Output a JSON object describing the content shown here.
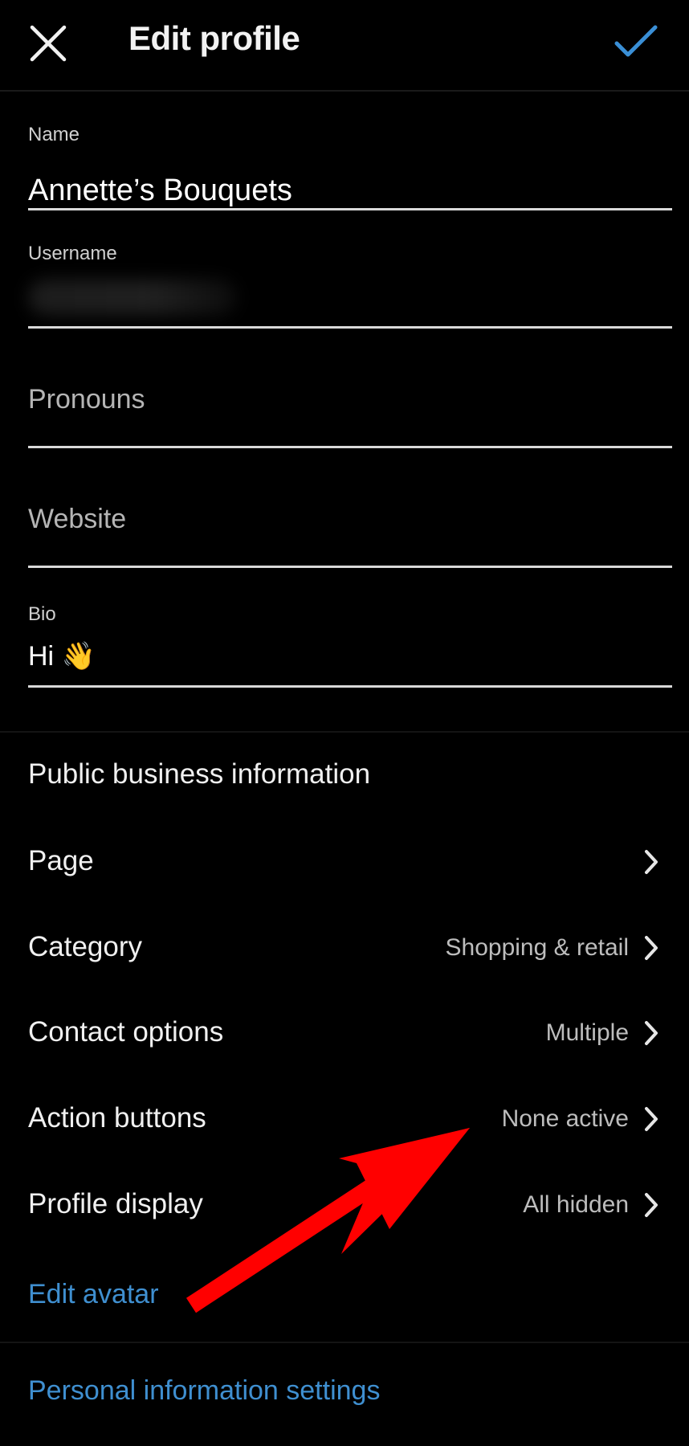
{
  "header": {
    "title": "Edit profile",
    "close_icon": "close-icon",
    "confirm_icon": "check-icon",
    "accent_color": "#3a8fd6"
  },
  "form": {
    "name": {
      "label": "Name",
      "value": "Annette’s Bouquets"
    },
    "username": {
      "label": "Username",
      "value_blurred": true
    },
    "pronouns": {
      "placeholder": "Pronouns"
    },
    "website": {
      "placeholder": "Website"
    },
    "bio": {
      "label": "Bio",
      "value": "Hi 👋"
    }
  },
  "business": {
    "section_title": "Public business information",
    "rows": [
      {
        "label": "Page",
        "value": ""
      },
      {
        "label": "Category",
        "value": "Shopping & retail"
      },
      {
        "label": "Contact options",
        "value": "Multiple"
      },
      {
        "label": "Action buttons",
        "value": "None active"
      },
      {
        "label": "Profile display",
        "value": "All hidden"
      }
    ]
  },
  "links": {
    "edit_avatar": "Edit avatar",
    "personal_info": "Personal information settings",
    "link_color": "#3f8fd0"
  },
  "annotation": {
    "arrow_color": "#ff0000",
    "arrow_icon": "red-arrow-annotation"
  }
}
